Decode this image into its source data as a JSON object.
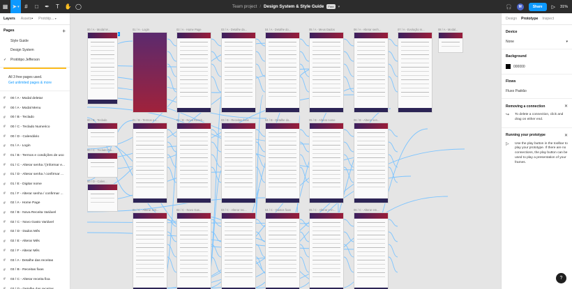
{
  "toolbar": {
    "tools": [
      {
        "name": "main-menu",
        "glyph": "▦"
      },
      {
        "name": "move-tool",
        "glyph": "➤"
      },
      {
        "name": "frame-tool",
        "glyph": "#"
      },
      {
        "name": "shape-tool",
        "glyph": "□"
      },
      {
        "name": "pen-tool",
        "glyph": "✒"
      },
      {
        "name": "text-tool",
        "glyph": "T"
      },
      {
        "name": "hand-tool",
        "glyph": "✋"
      },
      {
        "name": "comment-tool",
        "glyph": "◯"
      }
    ],
    "project": "Team project",
    "separator": "/",
    "file_name": "Design System & Style Guide",
    "plan_badge": "Free",
    "avatar_initial": "M",
    "share_label": "Share",
    "zoom_label": "31%"
  },
  "left_panel": {
    "tabs": {
      "layers": "Layers",
      "assets": "Assets",
      "prototype_page": "Protótip..."
    },
    "pages_heading": "Pages",
    "pages": [
      {
        "label": "Style Guide",
        "current": false
      },
      {
        "label": "Design System",
        "current": false
      },
      {
        "label": "Protótipo Jefferson",
        "current": true
      }
    ],
    "notice": {
      "text": "All 3 free pages used.",
      "link": "Get unlimited pages & more"
    },
    "layers": [
      "00 / A - Modal deletar",
      "00 / A - Modal Menu",
      "00 / B - Teclado",
      "00 / C - Teclado Numerico",
      "00 / D - Calendário",
      "01 / A - Login",
      "01 / B - Termos e condições de uso",
      "01 / C - Alterar senha / [Informar e...",
      "01 / D - Alterar senha / confirmar ...",
      "01 / E - Digitar nome",
      "01 / F - Alterar senha / confirmar ...",
      "02 / A - Home Page",
      "02 / B - Nova Receita Variável",
      "02 / C - Novo Gasto Variável",
      "02 / D - Dados Mês",
      "02 / E - Alterar Mês",
      "02 / F - Alterar Mês",
      "03 / A - Detalhe das receitas",
      "03 / B - Receitas fixas",
      "03 / C - Alterar receita fixa",
      "03 / D - Detalhe das receitas"
    ]
  },
  "canvas": {
    "flow_badge": "Fluxo Padrão",
    "frame_labels": [
      "00 / A - Modal M...",
      "01 / A - Login",
      "02 / A - Home Page",
      "03 / A - Detalhe da...",
      "04 / A - Detalhe do...",
      "05 / A - Meus Dados",
      "06 / A - Alterar senh...",
      "07 / A - Evolução m...",
      "08 / A - Modal...",
      "00 / B - Teclado",
      "01 / B - Termos e c...",
      "02 / B - Nova Receit...",
      "03 / B - Receitas fixas",
      "04 / B - Detalhe do...",
      "05 / B - Alterar nome",
      "06 / B - Alterar sen...",
      "00 / C - Teclado Nu...",
      "00 / D - Calen...",
      "01 / C - Alterar sen...",
      "02 / C - Novo Gas...",
      "03 / C - Alterar rec...",
      "04 / C - Gastos fixos",
      "05 / C - Alterar e-m...",
      "06 / C - Alterar em..."
    ]
  },
  "right_panel": {
    "tabs": {
      "design": "Design",
      "prototype": "Prototype",
      "inspect": "Inspect"
    },
    "device": {
      "title": "Device",
      "value": "None"
    },
    "background": {
      "title": "Background",
      "value": "000000",
      "color": "#000000"
    },
    "flows": {
      "title": "Flows",
      "value": "Fluxo Padrão"
    },
    "removing": {
      "title": "Removing a connection",
      "body": "To delete a connection, click and drag on either end."
    },
    "running": {
      "title": "Running your prototype",
      "body": "Use the play button in the toolbar to play your prototype. If there are no connections, the play button can be used to play a presentation of your frames."
    },
    "help_label": "?"
  }
}
